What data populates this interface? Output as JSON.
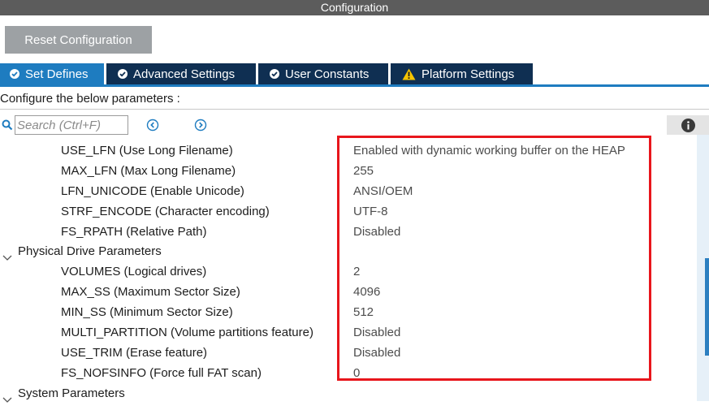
{
  "window": {
    "title": "Configuration"
  },
  "toolbar": {
    "reset_label": "Reset Configuration"
  },
  "tabs": [
    {
      "label": "Set Defines",
      "icon": "check-circle-icon",
      "active": true
    },
    {
      "label": "Advanced Settings",
      "icon": "check-circle-icon",
      "active": false
    },
    {
      "label": "User Constants",
      "icon": "check-circle-icon",
      "active": false
    },
    {
      "label": "Platform Settings",
      "icon": "warning-icon",
      "active": false
    }
  ],
  "instructions": "Configure the below parameters :",
  "search": {
    "placeholder": "Search (Ctrl+F)"
  },
  "params": [
    {
      "name": "USE_LFN (Use Long Filename)",
      "value": "Enabled with dynamic working buffer on the HEAP"
    },
    {
      "name": "MAX_LFN (Max Long Filename)",
      "value": "255"
    },
    {
      "name": "LFN_UNICODE (Enable Unicode)",
      "value": "ANSI/OEM"
    },
    {
      "name": "STRF_ENCODE (Character encoding)",
      "value": "UTF-8"
    },
    {
      "name": "FS_RPATH (Relative Path)",
      "value": "Disabled"
    }
  ],
  "groups": {
    "physical": {
      "label": "Physical Drive Parameters",
      "params": [
        {
          "name": "VOLUMES (Logical drives)",
          "value": "2"
        },
        {
          "name": "MAX_SS (Maximum Sector Size)",
          "value": "4096"
        },
        {
          "name": "MIN_SS (Minimum Sector Size)",
          "value": "512"
        },
        {
          "name": "MULTI_PARTITION (Volume partitions feature)",
          "value": "Disabled"
        },
        {
          "name": "USE_TRIM (Erase feature)",
          "value": "Disabled"
        },
        {
          "name": "FS_NOFSINFO (Force full FAT scan)",
          "value": "0"
        }
      ]
    },
    "system": {
      "label": "System Parameters"
    }
  },
  "colors": {
    "titlebar": "#5c5c5c",
    "tab_active": "#1e7cc0",
    "tab_inactive": "#0f2f52",
    "highlight": "#e8161c",
    "warning": "#f5c400"
  }
}
